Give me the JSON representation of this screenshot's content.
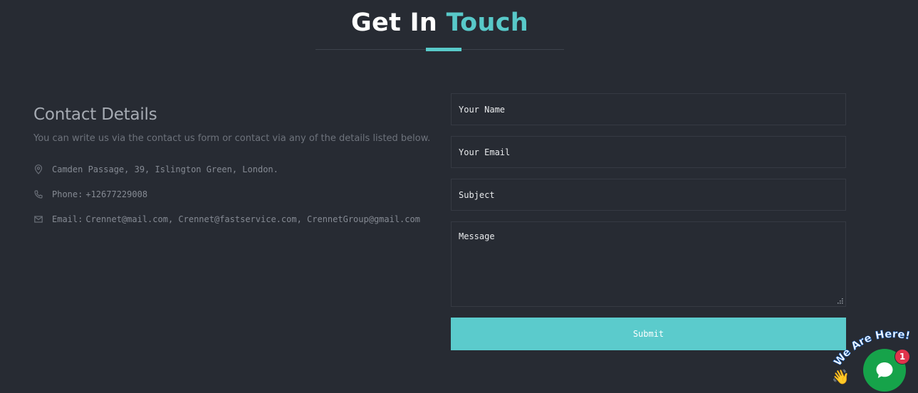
{
  "heading": {
    "part1": "Get In",
    "part2": "Touch"
  },
  "contact": {
    "title": "Contact Details",
    "description": "You can write us via the contact us form or contact via any of the details listed below.",
    "address": "Camden Passage, 39, Islington Green, London.",
    "phone_label": "Phone:",
    "phone": "+12677229008",
    "email_label": "Email:",
    "email": "Crennet@mail.com, Crennet@fastservice.com, CrennetGroup@gmail.com"
  },
  "form": {
    "name_placeholder": "Your Name",
    "email_placeholder": "Your Email",
    "subject_placeholder": "Subject",
    "message_placeholder": "Message",
    "submit_label": "Submit"
  },
  "chat": {
    "tagline": "We Are Here!",
    "badge_count": "1"
  },
  "colors": {
    "background": "#272b33",
    "accent": "#58c9c9",
    "chat_green": "#16a34a",
    "badge_red": "#e0334b"
  }
}
